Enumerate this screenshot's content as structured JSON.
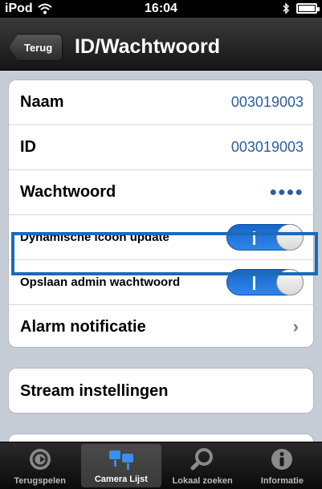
{
  "status_bar": {
    "carrier": "iPod",
    "time": "16:04"
  },
  "nav": {
    "back_label": "Terug",
    "title": "ID/Wachtwoord"
  },
  "settings": {
    "name_label": "Naam",
    "name_value": "003019003",
    "id_label": "ID",
    "id_value": "003019003",
    "password_label": "Wachtwoord",
    "password_value": "●●●●",
    "dynamic_icon_label": "Dynamische icoon update",
    "dynamic_icon_on": true,
    "save_admin_label": "Opslaan admin wachtwoord",
    "save_admin_on": true,
    "alarm_label": "Alarm notificatie",
    "stream_label": "Stream instellingen"
  },
  "tabs": [
    {
      "label": "Terugspelen",
      "icon": "replay-icon"
    },
    {
      "label": "Camera Lijst",
      "icon": "camera-list-icon"
    },
    {
      "label": "Lokaal zoeken",
      "icon": "search-icon"
    },
    {
      "label": "Informatie",
      "icon": "info-icon"
    }
  ],
  "colors": {
    "accent_blue": "#2f86ea",
    "value_blue": "#2a5ea0",
    "highlight_border": "#1b6bb8"
  }
}
